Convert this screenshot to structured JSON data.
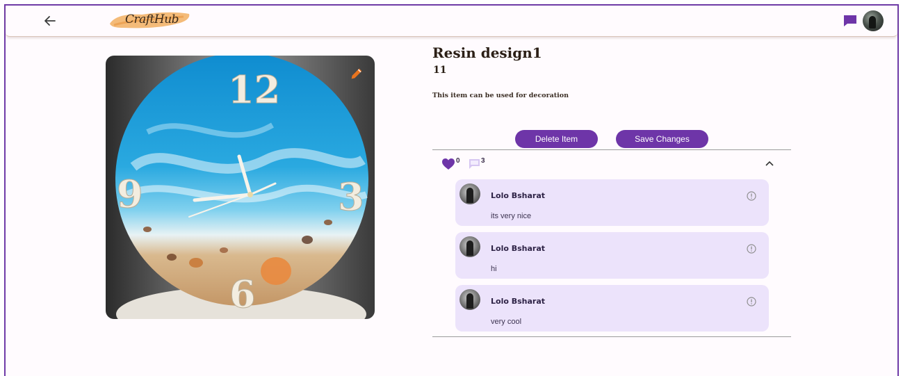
{
  "app": {
    "logo_text": "CraftHub",
    "accent_color": "#6e35a8"
  },
  "header": {
    "back_icon": "arrow-left-icon",
    "chat_icon": "chat-bubble-icon",
    "avatar": "user-avatar"
  },
  "item": {
    "title": "Resin design1",
    "quantity": "11",
    "description": "This item can be used for decoration",
    "image_alt": "Resin ocean wall clock",
    "edit_icon": "pencil-icon"
  },
  "actions": {
    "delete_label": "Delete Item",
    "save_label": "Save Changes"
  },
  "stats": {
    "likes": "0",
    "comments": "3"
  },
  "comments": [
    {
      "author": "Lolo Bsharat",
      "text": "its very nice"
    },
    {
      "author": "Lolo Bsharat",
      "text": "hi"
    },
    {
      "author": "Lolo Bsharat",
      "text": "very cool"
    }
  ]
}
